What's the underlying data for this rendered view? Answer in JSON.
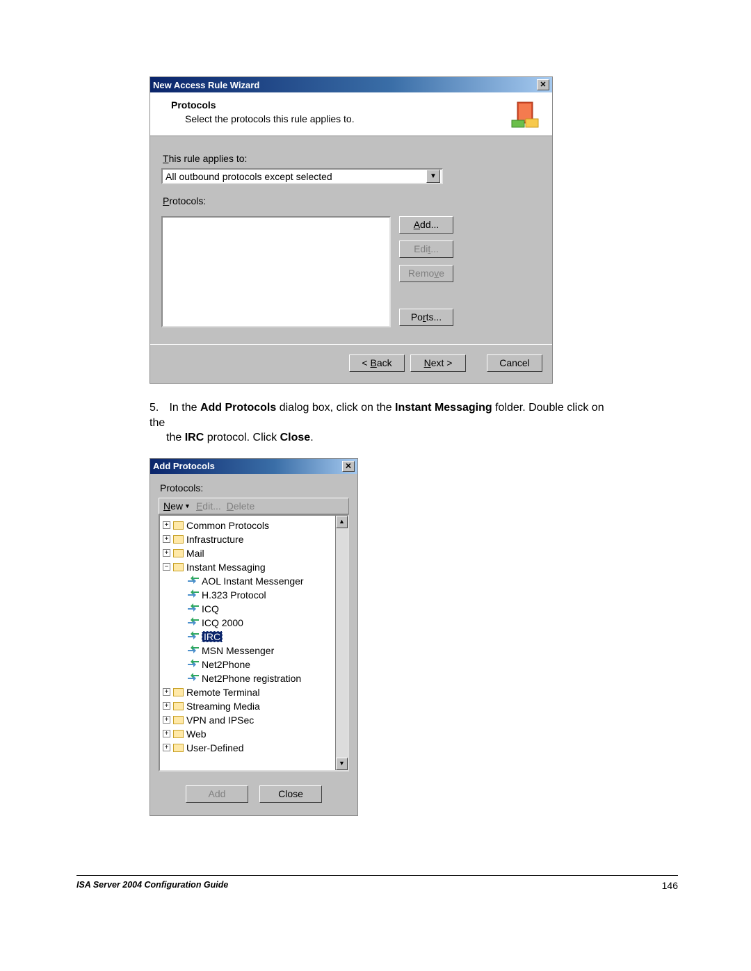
{
  "dlg1": {
    "title": "New Access Rule Wizard",
    "header_title": "Protocols",
    "header_sub": "Select the protocols this rule applies to.",
    "applies_label": "This rule applies to:",
    "applies_value": "All outbound protocols except selected",
    "protocols_label": "Protocols:",
    "add": "Add...",
    "edit": "Edit...",
    "remove": "Remove",
    "ports": "Ports...",
    "back": "< Back",
    "next": "Next >",
    "cancel": "Cancel"
  },
  "step": {
    "num": "5.",
    "t1": "In the ",
    "b1": "Add Protocols",
    "t2": " dialog box, click on the ",
    "b2": "Instant Messaging",
    "t3": " folder. Double click on the ",
    "b3": "IRC",
    "t4": " protocol. Click ",
    "b4": "Close",
    "t5": "."
  },
  "dlg2": {
    "title": "Add Protocols",
    "protocols_label": "Protocols:",
    "toolbar": {
      "new": "New",
      "edit": "Edit...",
      "delete": "Delete"
    },
    "folders": {
      "common": "Common Protocols",
      "infra": "Infrastructure",
      "mail": "Mail",
      "im": "Instant Messaging",
      "remote": "Remote Terminal",
      "stream": "Streaming Media",
      "vpn": "VPN and IPSec",
      "web": "Web",
      "user": "User-Defined"
    },
    "im_items": {
      "aol": "AOL Instant Messenger",
      "h323": "H.323 Protocol",
      "icq": "ICQ",
      "icq2000": "ICQ 2000",
      "irc": "IRC",
      "msn": "MSN Messenger",
      "net2phone": "Net2Phone",
      "net2phonereg": "Net2Phone registration"
    },
    "add": "Add",
    "close": "Close"
  },
  "footer": {
    "title": "ISA Server 2004 Configuration Guide",
    "page": "146"
  }
}
